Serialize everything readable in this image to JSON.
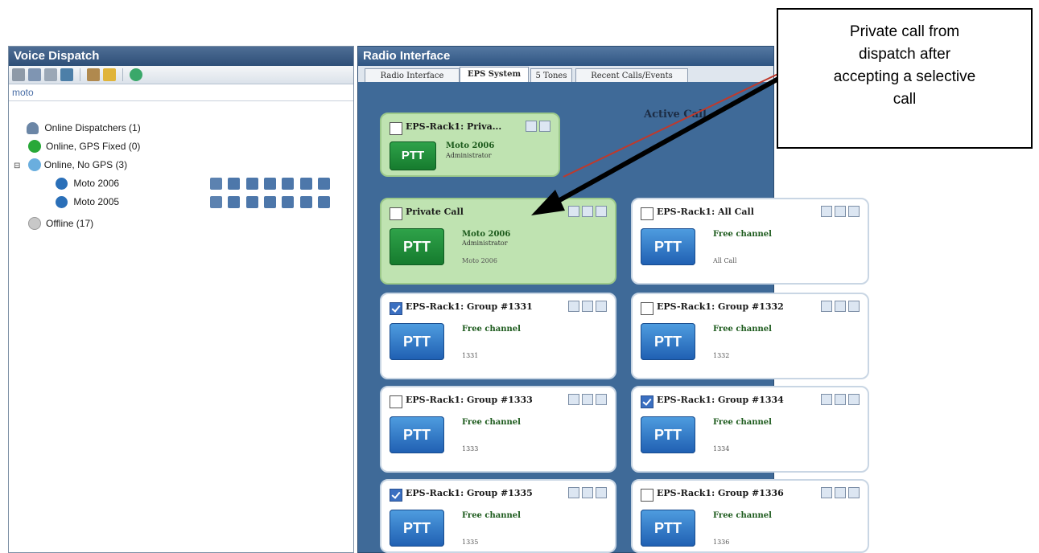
{
  "left_panel": {
    "title": "Voice Dispatch",
    "search_value": "moto",
    "tree": [
      {
        "label": "Online Dispatchers (1)",
        "icon": "dispatcher-icon"
      },
      {
        "label": "Online, GPS Fixed (0)",
        "color": "#28a838"
      },
      {
        "label": "Online, No GPS (3)",
        "color": "#6aaede",
        "expander": "⊟"
      },
      {
        "label": "Moto 2006",
        "icon": "radio-user-icon"
      },
      {
        "label": "Moto 2005",
        "icon": "radio-user-icon"
      },
      {
        "label": "Offline (17)",
        "color": "#c8c8c8"
      }
    ],
    "colors": {
      "gps_fixed": "#28a838",
      "no_gps": "#6aaede",
      "offline": "#c8c8c8"
    }
  },
  "right_panel": {
    "title": "Radio Interface",
    "tabs": [
      "Radio Interface",
      "EPS System",
      "5 Tones",
      "Recent Calls/Events"
    ],
    "active_tab": "EPS System",
    "active_call_label": "Active Call",
    "ptt_label": "PTT",
    "cards": [
      {
        "title": "EPS-Rack1: Priva...",
        "line1": "Moto 2006",
        "line2": "Administrator",
        "line3": "",
        "checked": false,
        "style": "green"
      },
      {
        "title": "Private Call",
        "line1": "Moto 2006",
        "line2": "Administrator",
        "line3": "Moto 2006",
        "checked": false,
        "style": "green"
      },
      {
        "title": "EPS-Rack1: All Call",
        "line1": "Free channel",
        "line2": "",
        "line3": "All Call",
        "checked": false,
        "style": "blue"
      },
      {
        "title": "EPS-Rack1: Group #1331",
        "line1": "Free channel",
        "line2": "",
        "line3": "1331",
        "checked": true,
        "style": "blue"
      },
      {
        "title": "EPS-Rack1: Group #1332",
        "line1": "Free channel",
        "line2": "",
        "line3": "1332",
        "checked": false,
        "style": "blue"
      },
      {
        "title": "EPS-Rack1: Group #1333",
        "line1": "Free channel",
        "line2": "",
        "line3": "1333",
        "checked": false,
        "style": "blue"
      },
      {
        "title": "EPS-Rack1: Group #1334",
        "line1": "Free channel",
        "line2": "",
        "line3": "1334",
        "checked": true,
        "style": "blue"
      },
      {
        "title": "EPS-Rack1: Group #1335",
        "line1": "Free channel",
        "line2": "",
        "line3": "1335",
        "checked": true,
        "style": "blue"
      },
      {
        "title": "EPS-Rack1: Group #1336",
        "line1": "Free channel",
        "line2": "",
        "line3": "1336",
        "checked": false,
        "style": "blue"
      }
    ]
  },
  "callout": {
    "lines": [
      "Private call from",
      "dispatch after",
      "accepting a selective",
      "call"
    ]
  }
}
